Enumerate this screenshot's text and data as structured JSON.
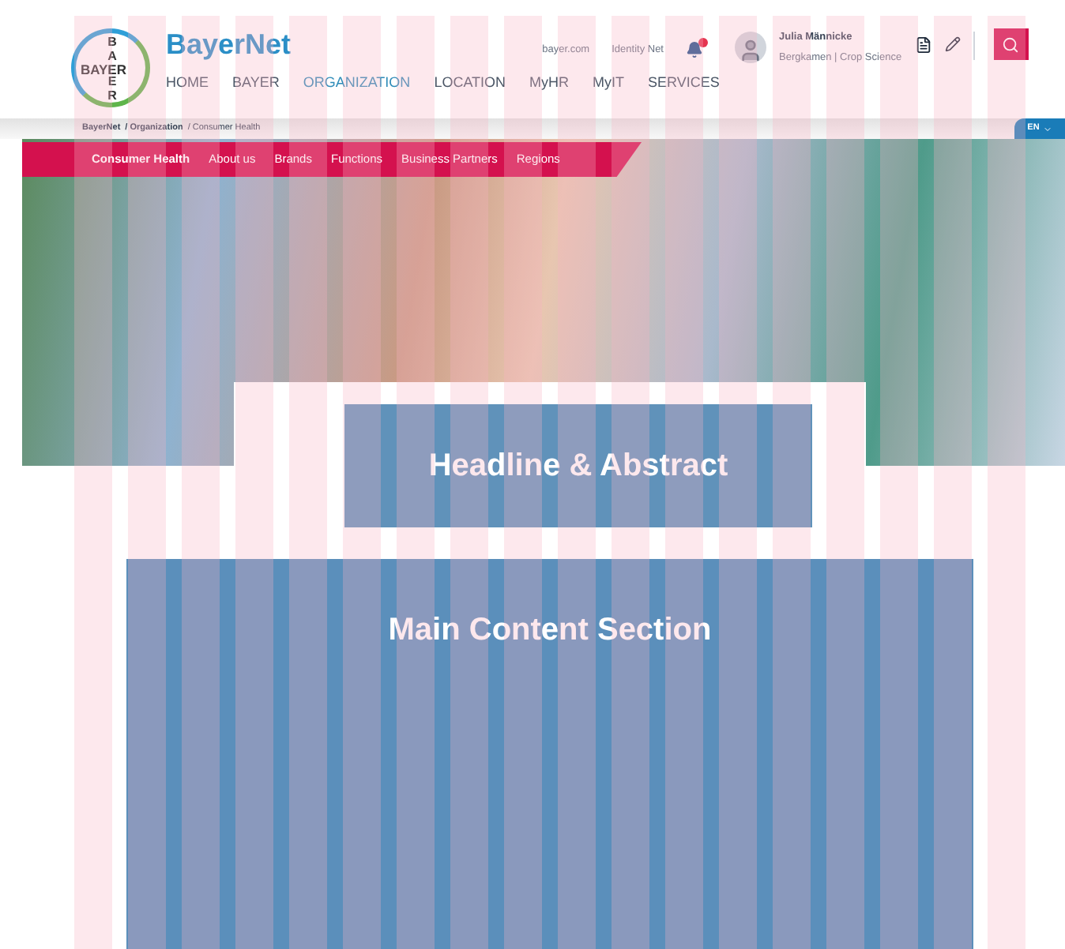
{
  "header": {
    "logo": {
      "horizontal": "BAYER",
      "vertical_top": "BA",
      "vertical_bottom": "ER"
    },
    "brand": "BayerNet",
    "top_links": [
      "bayer.com",
      "Identity Net"
    ],
    "notification": {
      "unread": true
    },
    "nav": [
      {
        "label": "HOME",
        "selected": false
      },
      {
        "label": "BAYER",
        "selected": false
      },
      {
        "label": "ORGANIZATION",
        "selected": true
      },
      {
        "label": "LOCATION",
        "selected": false
      },
      {
        "label": "MyHR",
        "selected": false
      },
      {
        "label": "MyIT",
        "selected": false
      },
      {
        "label": "SERVICES",
        "selected": false
      }
    ],
    "user": {
      "name": "Julia Männicke",
      "detail": "Bergkamen | Crop Science"
    }
  },
  "breadcrumb": [
    "BayerNet",
    "/ Organization",
    "/ Consumer Health"
  ],
  "language": "EN",
  "subnav": [
    {
      "label": "Consumer Health",
      "selected": true
    },
    {
      "label": "About us",
      "selected": false
    },
    {
      "label": "Brands",
      "selected": false
    },
    {
      "label": "Functions",
      "selected": false
    },
    {
      "label": "Business Partners",
      "selected": false
    },
    {
      "label": "Regions",
      "selected": false
    }
  ],
  "abstract": {
    "annotation": "Headline & Abstract"
  },
  "main": {
    "annotation": "Main Content Section"
  }
}
